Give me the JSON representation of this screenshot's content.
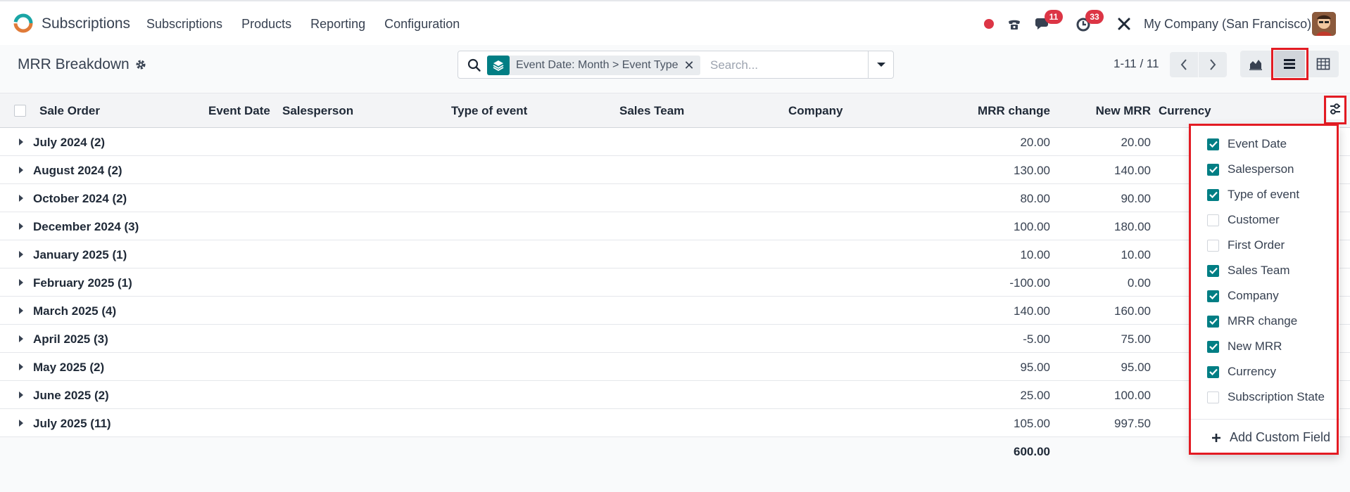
{
  "app": {
    "name": "Subscriptions",
    "logo_icon": "odoo-subscriptions-logo-icon"
  },
  "menu": [
    "Subscriptions",
    "Products",
    "Reporting",
    "Configuration"
  ],
  "systray": {
    "messages_count": "11",
    "activities_count": "33",
    "company": "My Company (San Francisco)"
  },
  "page": {
    "title": "MRR Breakdown"
  },
  "search": {
    "facet_label": "Event Date: Month > Event Type",
    "placeholder": "Search..."
  },
  "pager": {
    "text": "1-11 / 11"
  },
  "table": {
    "columns": [
      "Sale Order",
      "Event Date",
      "Salesperson",
      "Type of event",
      "Sales Team",
      "Company",
      "MRR change",
      "New MRR",
      "Currency"
    ],
    "groups": [
      {
        "label": "July 2024 (2)",
        "mrr_change": "20.00",
        "new_mrr": "20.00"
      },
      {
        "label": "August 2024 (2)",
        "mrr_change": "130.00",
        "new_mrr": "140.00"
      },
      {
        "label": "October 2024 (2)",
        "mrr_change": "80.00",
        "new_mrr": "90.00"
      },
      {
        "label": "December 2024 (3)",
        "mrr_change": "100.00",
        "new_mrr": "180.00"
      },
      {
        "label": "January 2025 (1)",
        "mrr_change": "10.00",
        "new_mrr": "10.00"
      },
      {
        "label": "February 2025 (1)",
        "mrr_change": "-100.00",
        "new_mrr": "0.00"
      },
      {
        "label": "March 2025 (4)",
        "mrr_change": "140.00",
        "new_mrr": "160.00"
      },
      {
        "label": "April 2025 (3)",
        "mrr_change": "-5.00",
        "new_mrr": "75.00"
      },
      {
        "label": "May 2025 (2)",
        "mrr_change": "95.00",
        "new_mrr": "95.00"
      },
      {
        "label": "June 2025 (2)",
        "mrr_change": "25.00",
        "new_mrr": "100.00"
      },
      {
        "label": "July 2025 (11)",
        "mrr_change": "105.00",
        "new_mrr": "997.50"
      }
    ],
    "total_mrr_change": "600.00"
  },
  "optional_columns": {
    "items": [
      {
        "label": "Event Date",
        "checked": true
      },
      {
        "label": "Salesperson",
        "checked": true
      },
      {
        "label": "Type of event",
        "checked": true
      },
      {
        "label": "Customer",
        "checked": false
      },
      {
        "label": "First Order",
        "checked": false
      },
      {
        "label": "Sales Team",
        "checked": true
      },
      {
        "label": "Company",
        "checked": true
      },
      {
        "label": "MRR change",
        "checked": true
      },
      {
        "label": "New MRR",
        "checked": true
      },
      {
        "label": "Currency",
        "checked": true
      },
      {
        "label": "Subscription State",
        "checked": false
      }
    ],
    "add_custom_field": "Add Custom Field"
  },
  "colors": {
    "accent": "#017e84",
    "highlight": "#e31b23",
    "badge": "#dc3545"
  }
}
